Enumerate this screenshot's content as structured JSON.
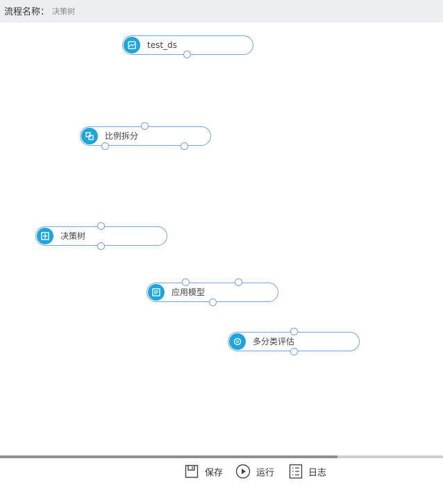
{
  "header": {
    "label": "流程名称：",
    "value": "决策树"
  },
  "nodes": [
    {
      "id": "test_ds",
      "label": "test_ds",
      "icon": "dataset-icon"
    },
    {
      "id": "split",
      "label": "比例拆分",
      "icon": "split-icon"
    },
    {
      "id": "tree",
      "label": "决策树",
      "icon": "tree-icon"
    },
    {
      "id": "apply",
      "label": "应用模型",
      "icon": "apply-model-icon"
    },
    {
      "id": "eval",
      "label": "多分类评估",
      "icon": "evaluate-icon"
    }
  ],
  "footer": {
    "save": "保存",
    "run": "运行",
    "log": "日志"
  },
  "colors": {
    "accent": "#1fa5d9",
    "node_border": "#7aa3e0"
  }
}
